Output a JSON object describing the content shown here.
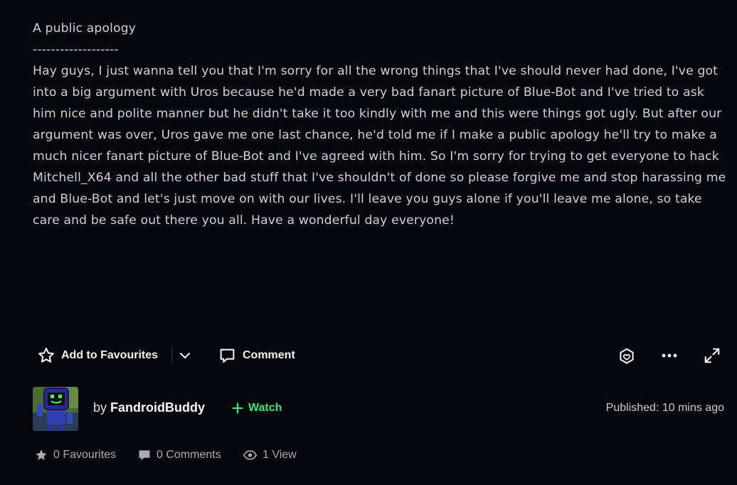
{
  "deviation": {
    "title": "A public apology",
    "separator": "-------------------",
    "body": "Hay guys, I just wanna tell you that I'm sorry for all the wrong things that I've should never had done, I've got into a big argument with Uros because he'd made a very bad fanart picture of Blue-Bot and I've tried to ask him nice and polite manner but he didn't take it too kindly with me and this were things got ugly. But after our argument was over, Uros gave me one last chance, he'd told me if I make a public apology he'll try to make a much nicer fanart picture of Blue-Bot and I've agreed with him. So I'm sorry for trying to get everyone to hack Mitchell_X64 and all the other bad stuff that I've shouldn't of done so please forgive me and stop harassing me and Blue-Bot and let's just move on with our lives. I'll leave you guys alone if you'll leave me alone, so take care and be safe out there you all. Have a wonderful day everyone!"
  },
  "actions": {
    "favourite_label": "Add to Favourites",
    "comment_label": "Comment",
    "icons": [
      "star-outline-icon",
      "chevron-down-icon",
      "comment-icon",
      "give-gift-icon",
      "more-options-icon",
      "expand-icon"
    ]
  },
  "author": {
    "by_prefix": "by",
    "name": "FandroidBuddy",
    "watch_label": "Watch",
    "published": "Published: 10 mins ago",
    "accent_color": "#2fe87a"
  },
  "stats": {
    "favourites": "0 Favourites",
    "comments": "0 Comments",
    "views": "1 View"
  }
}
